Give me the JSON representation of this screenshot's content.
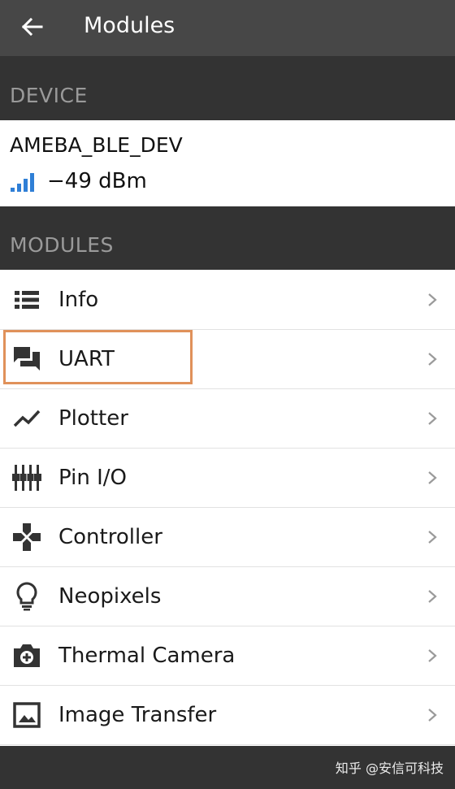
{
  "app_bar": {
    "title": "Modules",
    "back_icon": "arrow-left-icon"
  },
  "device_section": {
    "header": "DEVICE",
    "device_name": "AMEBA_BLE_DEV",
    "rssi": "−49 dBm",
    "signal_icon": "signal-bars-icon"
  },
  "modules_section": {
    "header": "MODULES",
    "items": [
      {
        "label": "Info",
        "icon": "list-icon"
      },
      {
        "label": "UART",
        "icon": "chat-icon"
      },
      {
        "label": "Plotter",
        "icon": "line-chart-icon"
      },
      {
        "label": "Pin I/O",
        "icon": "sliders-icon"
      },
      {
        "label": "Controller",
        "icon": "dpad-icon"
      },
      {
        "label": "Neopixels",
        "icon": "lightbulb-icon"
      },
      {
        "label": "Thermal Camera",
        "icon": "camera-icon"
      },
      {
        "label": "Image Transfer",
        "icon": "image-icon"
      }
    ]
  },
  "highlight_color": "#e0915a",
  "accent_color": "#2f7fd6",
  "watermark": "知乎 @安信可科技"
}
